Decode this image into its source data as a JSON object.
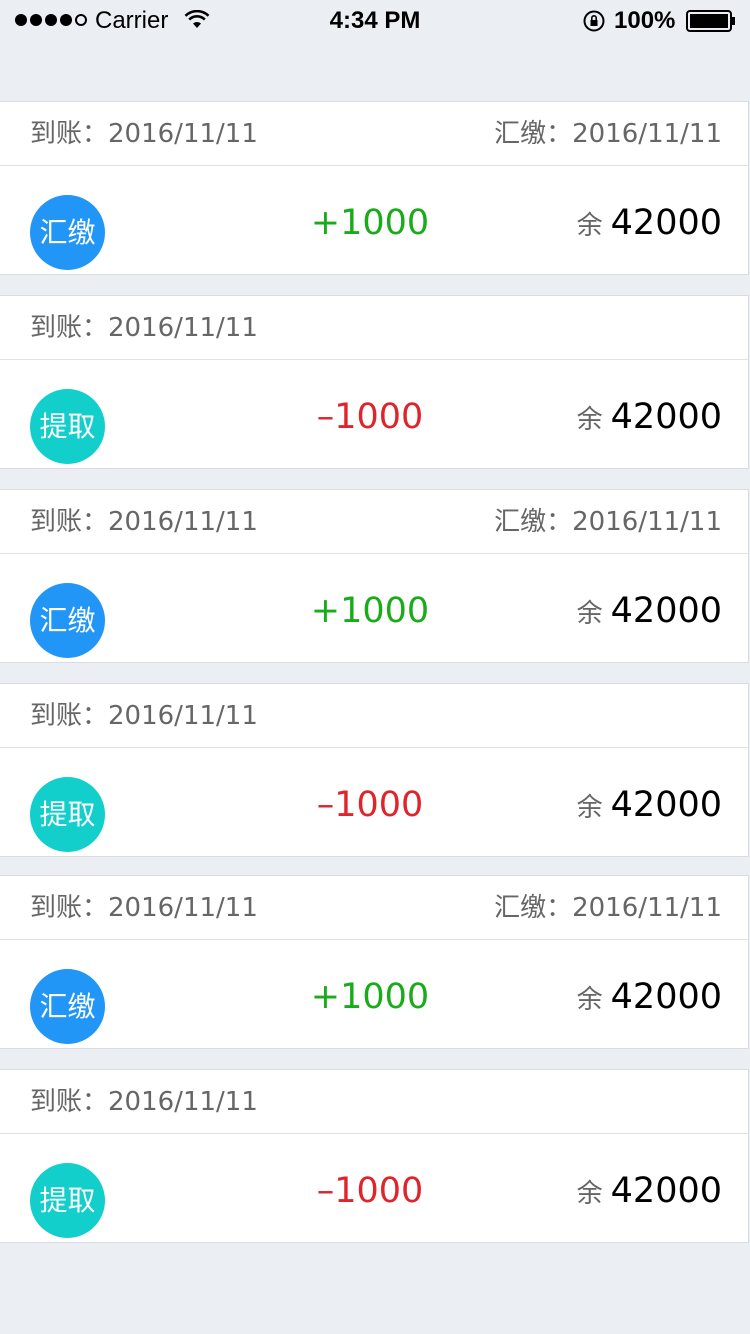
{
  "status_bar": {
    "carrier": "Carrier",
    "time": "4:34 PM",
    "battery": "100%"
  },
  "colors": {
    "page_bg": "#ebeff3",
    "remit_badge": "#2196f7",
    "withdraw_badge": "#12cfcb",
    "positive": "#1aab1a",
    "negative": "#e0242b"
  },
  "records": [
    {
      "arrive_label": "到账：",
      "arrive_date": "2016/11/11",
      "remit_label": "汇缴：",
      "remit_date": "2016/11/11",
      "type": "汇缴",
      "kind": "remit",
      "amount": "+1000",
      "balance_label": "余",
      "balance": "42000"
    },
    {
      "arrive_label": "到账：",
      "arrive_date": "2016/11/11",
      "remit_label": "",
      "remit_date": "",
      "type": "提取",
      "kind": "withdraw",
      "amount": "–1000",
      "balance_label": "余",
      "balance": "42000"
    },
    {
      "arrive_label": "到账：",
      "arrive_date": "2016/11/11",
      "remit_label": "汇缴：",
      "remit_date": "2016/11/11",
      "type": "汇缴",
      "kind": "remit",
      "amount": "+1000",
      "balance_label": "余",
      "balance": "42000"
    },
    {
      "arrive_label": "到账：",
      "arrive_date": "2016/11/11",
      "remit_label": "",
      "remit_date": "",
      "type": "提取",
      "kind": "withdraw",
      "amount": "–1000",
      "balance_label": "余",
      "balance": "42000"
    },
    {
      "arrive_label": "到账：",
      "arrive_date": "2016/11/11",
      "remit_label": "汇缴：",
      "remit_date": "2016/11/11",
      "type": "汇缴",
      "kind": "remit",
      "amount": "+1000",
      "balance_label": "余",
      "balance": "42000"
    },
    {
      "arrive_label": "到账：",
      "arrive_date": "2016/11/11",
      "remit_label": "",
      "remit_date": "",
      "type": "提取",
      "kind": "withdraw",
      "amount": "–1000",
      "balance_label": "余",
      "balance": "42000"
    }
  ]
}
